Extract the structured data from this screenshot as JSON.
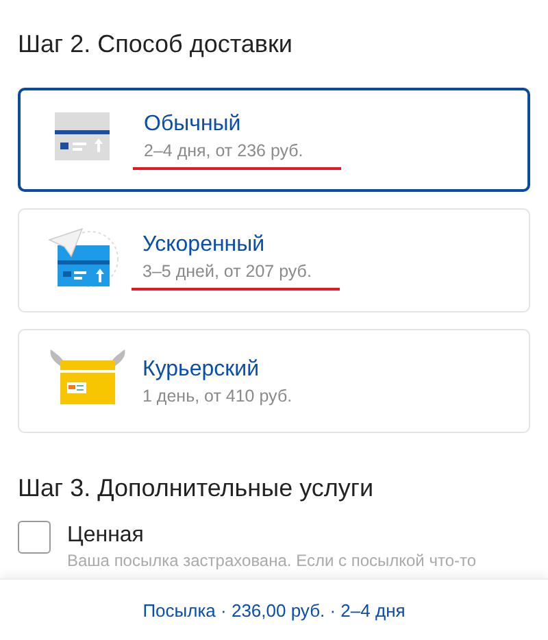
{
  "step2_title": "Шаг 2. Способ доставки",
  "options": [
    {
      "kind": "standard",
      "name": "Обычный",
      "details": "2–4 дня, от 236 руб.",
      "selected": true,
      "underlined": true
    },
    {
      "kind": "express",
      "name": "Ускоренный",
      "details": "3–5 дней, от 207 руб.",
      "selected": false,
      "underlined": true
    },
    {
      "kind": "courier",
      "name": "Курьерский",
      "details": "1 день, от 410 руб.",
      "selected": false,
      "underlined": false
    }
  ],
  "step3_title": "Шаг 3. Дополнительные услуги",
  "services": [
    {
      "name": "Ценная",
      "description": "Ваша посылка застрахована. Если с посылкой что-то",
      "checked": false
    }
  ],
  "summary": "Посылка · 236,00 руб. · 2–4 дня"
}
